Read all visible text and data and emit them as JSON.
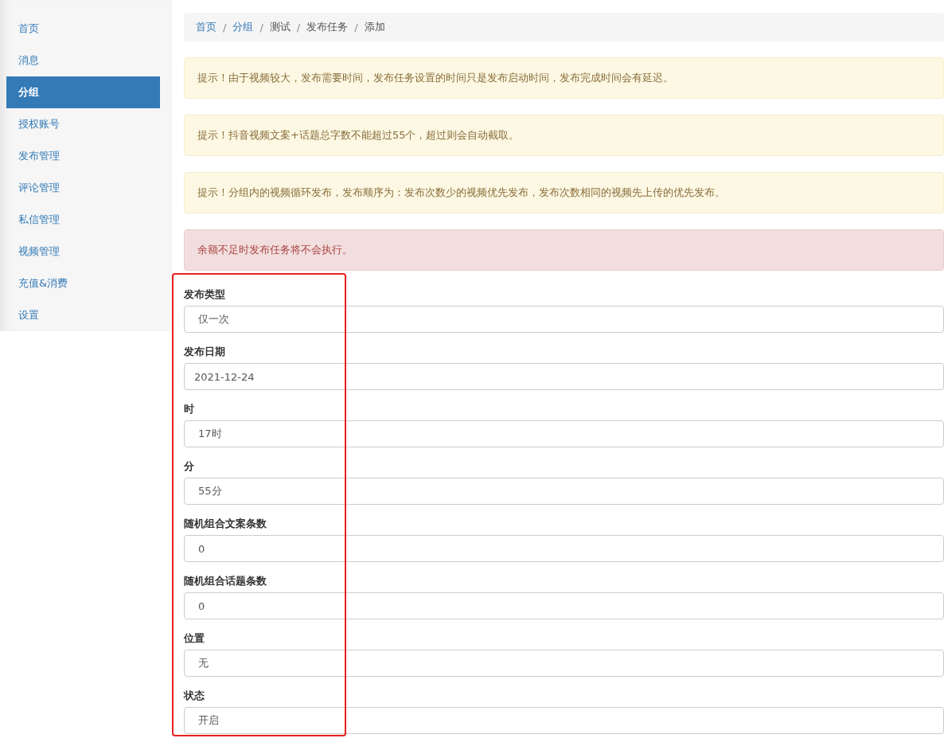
{
  "sidebar": {
    "items": [
      {
        "label": "首页",
        "selected": false
      },
      {
        "label": "消息",
        "selected": false
      },
      {
        "label": "分组",
        "selected": true
      },
      {
        "label": "授权账号",
        "selected": false
      },
      {
        "label": "发布管理",
        "selected": false
      },
      {
        "label": "评论管理",
        "selected": false
      },
      {
        "label": "私信管理",
        "selected": false
      },
      {
        "label": "视频管理",
        "selected": false
      },
      {
        "label": "充值&消费",
        "selected": false
      },
      {
        "label": "设置",
        "selected": false
      }
    ]
  },
  "breadcrumb": [
    {
      "label": "首页",
      "kind": "link"
    },
    {
      "label": "分组",
      "kind": "link"
    },
    {
      "label": "测试",
      "kind": "text"
    },
    {
      "label": "发布任务",
      "kind": "text"
    },
    {
      "label": "添加",
      "kind": "text"
    }
  ],
  "breadcrumb_separator": "/",
  "alerts": [
    {
      "kind": "warning",
      "text": "提示！由于视频较大，发布需要时间，发布任务设置的时间只是发布启动时间，发布完成时间会有延迟。"
    },
    {
      "kind": "warning",
      "text": "提示！抖音视频文案+话题总字数不能超过55个，超过则会自动截取。"
    },
    {
      "kind": "warning",
      "text": "提示！分组内的视频循环发布，发布顺序为：发布次数少的视频优先发布，发布次数相同的视频先上传的优先发布。"
    },
    {
      "kind": "danger",
      "text": "余额不足时发布任务将不会执行。"
    }
  ],
  "form": {
    "highlighted": true,
    "fields": [
      {
        "label": "发布类型",
        "kind": "select",
        "value": "仅一次"
      },
      {
        "label": "发布日期",
        "kind": "input",
        "value": "2021-12-24"
      },
      {
        "label": "时",
        "kind": "select",
        "value": "17时"
      },
      {
        "label": "分",
        "kind": "select",
        "value": "55分"
      },
      {
        "label": "随机组合文案条数",
        "kind": "select",
        "value": "0"
      },
      {
        "label": "随机组合话题条数",
        "kind": "select",
        "value": "0"
      },
      {
        "label": "位置",
        "kind": "select",
        "value": "无"
      },
      {
        "label": "状态",
        "kind": "select",
        "value": "开启"
      }
    ]
  }
}
